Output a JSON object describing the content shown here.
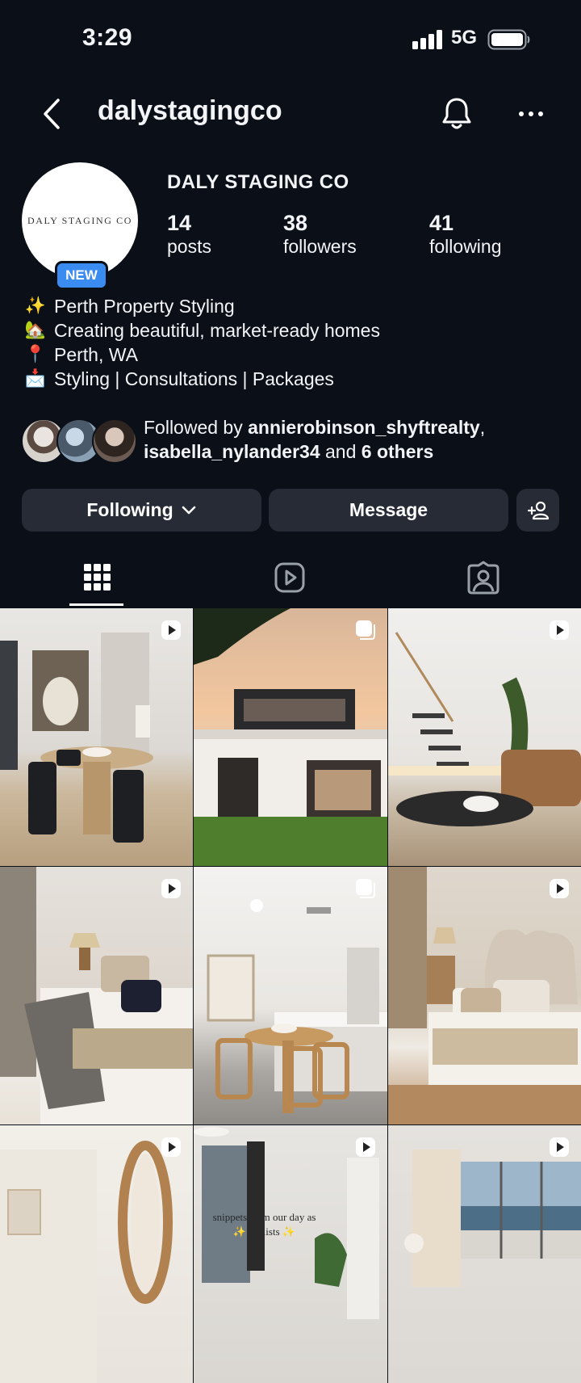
{
  "status_bar": {
    "time": "3:29",
    "network": "5G"
  },
  "header": {
    "username": "dalystagingco"
  },
  "profile": {
    "avatar_text": "DALY STAGING CO",
    "new_badge": "NEW",
    "display_name": "DALY STAGING CO",
    "stats": {
      "posts": {
        "value": "14",
        "label": "posts"
      },
      "followers": {
        "value": "38",
        "label": "followers"
      },
      "following": {
        "value": "41",
        "label": "following"
      }
    }
  },
  "bio": [
    {
      "emoji": "✨",
      "text": "Perth Property Styling"
    },
    {
      "emoji": "🏡",
      "text": "Creating beautiful, market-ready homes"
    },
    {
      "emoji": "📍",
      "text": "Perth, WA"
    },
    {
      "emoji": "📩",
      "text": "Styling | Consultations | Packages"
    }
  ],
  "followed_by": {
    "prefix": "Followed by ",
    "user1": "annierobinson_shyftrealty",
    "sep": ",",
    "user2": "isabella_nylander34",
    "middle": " and ",
    "others": "6 others"
  },
  "buttons": {
    "following": "Following",
    "message": "Message"
  },
  "tabs": [
    "grid-icon",
    "reels-icon",
    "tagged-icon"
  ],
  "posts": [
    {
      "type": "reel"
    },
    {
      "type": "carousel"
    },
    {
      "type": "reel"
    },
    {
      "type": "reel"
    },
    {
      "type": "carousel"
    },
    {
      "type": "reel"
    },
    {
      "type": "reel"
    },
    {
      "type": "reel",
      "caption_line1": "snippets from our day as",
      "caption_line2": "✨ Stylists ✨"
    },
    {
      "type": "reel"
    }
  ]
}
